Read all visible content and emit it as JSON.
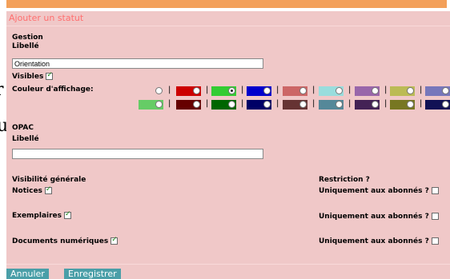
{
  "page": {
    "bg_letter_1": "r",
    "bg_letter_2": "u"
  },
  "panel": {
    "title": "Ajouter un statut"
  },
  "gestion": {
    "heading": "Gestion",
    "libelle_label": "Libellé",
    "libelle_value": "Orientation",
    "visibles_label": "Visibles",
    "visibles_checked": true,
    "couleur_label": "Couleur d'affichage:",
    "colors_row1": [
      "#ffffff",
      "#cc0000",
      "#33cc33",
      "#0000cc",
      "#cc6666",
      "#99dddd",
      "#9966aa",
      "#bbbb55",
      "#7777bb"
    ],
    "colors_row2": [
      "#66cc66",
      "#660000",
      "#006600",
      "#000066",
      "#663333",
      "#558899",
      "#442255",
      "#777722",
      "#111155"
    ],
    "selected_color": "#33cc33",
    "separator": "|"
  },
  "opac": {
    "heading": "OPAC",
    "libelle_label": "Libellé",
    "libelle_value": ""
  },
  "visibility": {
    "general_heading": "Visibilité générale",
    "restriction_heading": "Restriction ?",
    "rows": [
      {
        "label": "Notices",
        "checked": true,
        "restriction_label": "Uniquement aux abonnés ?",
        "restriction_checked": false
      },
      {
        "label": "Exemplaires",
        "checked": true,
        "restriction_label": "Uniquement aux abonnés ?",
        "restriction_checked": false
      },
      {
        "label": "Documents numériques",
        "checked": true,
        "restriction_label": "Uniquement aux abonnés ?",
        "restriction_checked": false
      }
    ]
  },
  "buttons": {
    "cancel": "Annuler",
    "save": "Enregistrer"
  }
}
